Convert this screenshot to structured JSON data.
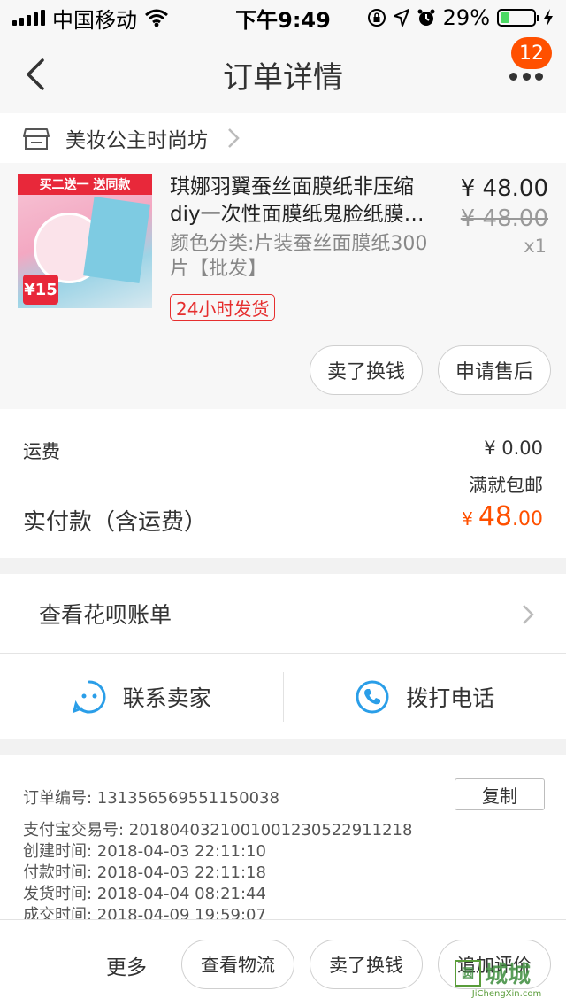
{
  "status_bar": {
    "carrier": "中国移动",
    "time": "下午9:49",
    "battery": "29%",
    "battery_level": 0.29
  },
  "nav": {
    "title": "订单详情",
    "badge": "12"
  },
  "shop": {
    "name": "美妆公主时尚坊"
  },
  "product": {
    "image_banner": "买二送一 送同款",
    "image_tag": "¥15",
    "title": "琪娜羽翼蚕丝面膜纸非压缩diy一次性面膜纸鬼脸纸膜…",
    "sku": "颜色分类:片装蚕丝面膜纸300片【批发】",
    "price": "¥ 48.00",
    "original_price": "¥ 48.00",
    "quantity": "x1",
    "tag": "24小时发货",
    "sell_button": "卖了换钱",
    "aftersale_button": "申请售后"
  },
  "fee": {
    "shipping_label": "运费",
    "shipping_value": "¥ 0.00",
    "shipping_note": "满就包邮",
    "paid_label": "实付款（含运费）",
    "paid_currency": "¥",
    "paid_int": "48",
    "paid_dec": ".00"
  },
  "huabei": {
    "label": "查看花呗账单"
  },
  "contact": {
    "seller": "联系卖家",
    "phone": "拨打电话"
  },
  "order_info": {
    "order_no": "订单编号:   131356569551150038",
    "copy_button": "复制",
    "alipay_no": "支付宝交易号:   2018040321001001230522911218",
    "created": "创建时间:   2018-04-03 22:11:10",
    "paid": "付款时间:   2018-04-03 22:11:18",
    "shipped": "发货时间:   2018-04-04 08:21:44",
    "completed": "成交时间:   2018-04-09 19:59:07"
  },
  "bottom_bar": {
    "more": "更多",
    "logistics": "查看物流",
    "sell": "卖了换钱",
    "review": "追加评价"
  },
  "watermark": {
    "main": "城城",
    "box": "圆",
    "sub": "JiChengXin.com"
  },
  "icons": {
    "back": "chevron-left-icon",
    "more": "more-dots-icon",
    "shop": "shop-icon",
    "chevron": "chevron-right-icon",
    "seller": "chat-face-icon",
    "phone": "phone-icon",
    "wifi": "wifi-icon",
    "lock": "orientation-lock-icon",
    "location": "location-arrow-icon",
    "alarm": "alarm-icon",
    "charging": "charging-bolt-icon"
  },
  "colors": {
    "accent": "#ff5000",
    "tag_red": "#e62e2e",
    "contact_blue": "#2a9ee8",
    "battery_green": "#4cd964"
  }
}
